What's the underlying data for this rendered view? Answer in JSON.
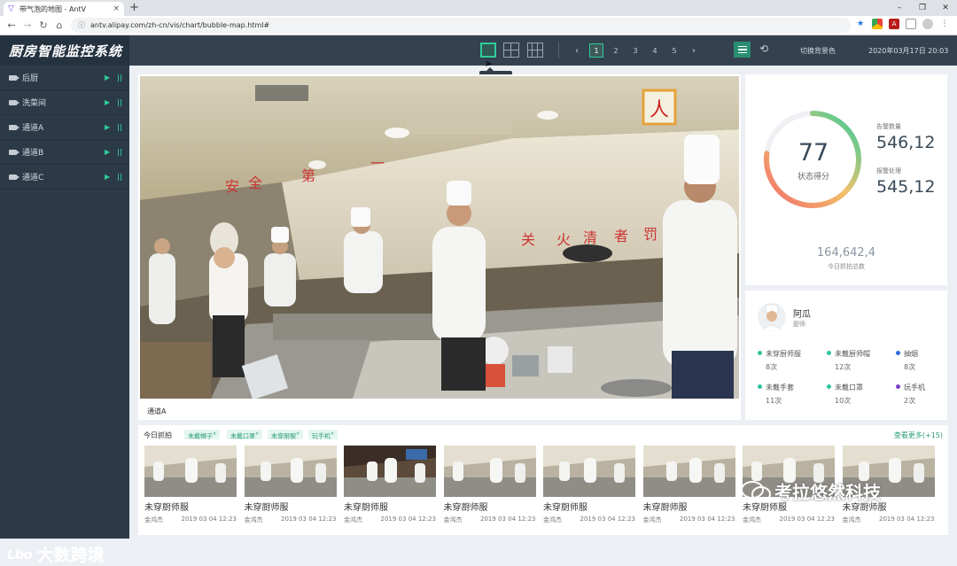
{
  "browser": {
    "tab_title": "带气泡的地图 - AntV",
    "url": "antv.alipay.com/zh-cn/vis/chart/bubble-map.html#",
    "close": "×",
    "new_tab": "+",
    "win_min": "–",
    "win_max": "❐",
    "win_close": "✕"
  },
  "app": {
    "title": "厨房智能监控系统"
  },
  "sidebar": {
    "items": [
      {
        "label": "后厨"
      },
      {
        "label": "洗菜间"
      },
      {
        "label": "通道A"
      },
      {
        "label": "通道B"
      },
      {
        "label": "通道C"
      }
    ]
  },
  "toolbar": {
    "pages": [
      "1",
      "2",
      "3",
      "4",
      "5"
    ],
    "active_page": "1",
    "switch_bg": "切换背景色",
    "datetime": "2020年03月17日 20:03",
    "tooltip": "一宫格"
  },
  "video": {
    "caption": "通道A"
  },
  "stats": {
    "score": "77",
    "score_label": "状态得分",
    "score_fraction": 0.77,
    "metric1_label": "告警数量",
    "metric1_value": "546,12",
    "metric2_label": "报警处理",
    "metric2_value": "545,12",
    "total_value": "164,642,4",
    "total_label": "今日抓拍总数"
  },
  "person": {
    "name": "阿瓜",
    "role": "厨师",
    "counts": [
      {
        "label": "未穿厨师服",
        "value": "8次",
        "color": "#2ec4a0"
      },
      {
        "label": "未戴厨师帽",
        "value": "12次",
        "color": "#2ec4a0"
      },
      {
        "label": "抽烟",
        "value": "8次",
        "color": "#2b6cd6"
      },
      {
        "label": "未戴手套",
        "value": "11次",
        "color": "#2ec4a0"
      },
      {
        "label": "未戴口罩",
        "value": "10次",
        "color": "#2ec4a0"
      },
      {
        "label": "玩手机",
        "value": "2次",
        "color": "#7b3fc8"
      }
    ]
  },
  "capture": {
    "title": "今日抓拍",
    "tags": [
      "未戴帽子",
      "未戴口罩",
      "未穿厨服",
      "玩手机"
    ],
    "more": "查看更多(+15)",
    "items": [
      {
        "label": "未穿厨师服",
        "name": "金鸿杰",
        "time": "2019 03 04 12:23"
      },
      {
        "label": "未穿厨师服",
        "name": "金鸿杰",
        "time": "2019 03 04 12:23"
      },
      {
        "label": "未穿厨师服",
        "name": "金鸿杰",
        "time": "2019 03 04 12:23"
      },
      {
        "label": "未穿厨师服",
        "name": "金鸿杰",
        "time": "2019 03 04 12:23"
      },
      {
        "label": "未穿厨师服",
        "name": "金鸿杰",
        "time": "2019 03 04 12:23"
      },
      {
        "label": "未穿厨师服",
        "name": "金鸿杰",
        "time": "2019 03 04 12:23"
      },
      {
        "label": "未穿厨师服",
        "name": "金鸿杰",
        "time": "2019 03 04 12:23"
      },
      {
        "label": "未穿厨师服",
        "name": "金鸿杰",
        "time": "2019 03 04 12:23"
      }
    ]
  },
  "watermarks": {
    "left_logo": "Lbo",
    "left": "大数跨境",
    "right": "考拉悠然科技"
  }
}
